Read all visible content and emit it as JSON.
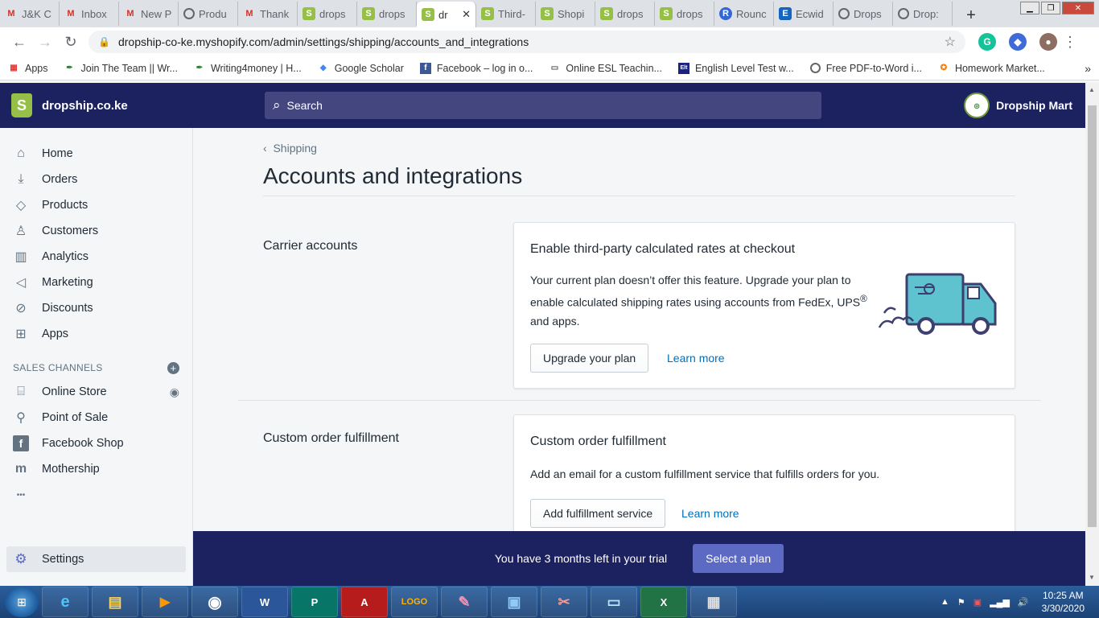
{
  "browser": {
    "tabs": [
      {
        "label": "J&K C",
        "icon": "gmail-icon",
        "glyph": "M"
      },
      {
        "label": "Inbox",
        "icon": "gmail-icon",
        "glyph": "M"
      },
      {
        "label": "New P",
        "icon": "gmail-icon",
        "glyph": "M"
      },
      {
        "label": "Produ",
        "icon": "globe-icon",
        "glyph": ""
      },
      {
        "label": "Thank",
        "icon": "gmail-icon",
        "glyph": "M"
      },
      {
        "label": "drops",
        "icon": "shopify-icon",
        "glyph": "S"
      },
      {
        "label": "drops",
        "icon": "shopify-icon",
        "glyph": "S"
      },
      {
        "label": "dr",
        "icon": "shopify-icon",
        "glyph": "S",
        "active": true
      },
      {
        "label": "Third-",
        "icon": "shopify-icon",
        "glyph": "S"
      },
      {
        "label": "Shopi",
        "icon": "shopify-icon",
        "glyph": "S"
      },
      {
        "label": "drops",
        "icon": "shopify-icon",
        "glyph": "S"
      },
      {
        "label": "drops",
        "icon": "shopify-icon",
        "glyph": "S"
      },
      {
        "label": "Rounc",
        "icon": "roundcube-icon",
        "glyph": "R"
      },
      {
        "label": "Ecwid",
        "icon": "ecwid-icon",
        "glyph": "E"
      },
      {
        "label": "Drops",
        "icon": "globe-icon",
        "glyph": ""
      },
      {
        "label": "Drop:",
        "icon": "globe-icon",
        "glyph": ""
      }
    ],
    "url": "dropship-co-ke.myshopify.com/admin/settings/shipping/accounts_and_integrations",
    "bookmarks": [
      {
        "label": "Apps",
        "icon": "apps-grid-icon"
      },
      {
        "label": "Join The Team || Wr...",
        "icon": "feather-icon"
      },
      {
        "label": "Writing4money | H...",
        "icon": "feather-icon"
      },
      {
        "label": "Google Scholar",
        "icon": "scholar-cap-icon"
      },
      {
        "label": "Facebook – log in o...",
        "icon": "facebook-icon"
      },
      {
        "label": "Online ESL Teachin...",
        "icon": "monitor-icon"
      },
      {
        "label": "English Level Test w...",
        "icon": "elt-icon"
      },
      {
        "label": "Free PDF-to-Word i...",
        "icon": "globe-icon"
      },
      {
        "label": "Homework Market...",
        "icon": "homework-icon"
      }
    ]
  },
  "topbar": {
    "store_name": "dropship.co.ke",
    "search_placeholder": "Search",
    "account_name": "Dropship Mart"
  },
  "sidebar": {
    "items": [
      {
        "label": "Home",
        "icon": "home-icon"
      },
      {
        "label": "Orders",
        "icon": "orders-icon"
      },
      {
        "label": "Products",
        "icon": "tag-icon"
      },
      {
        "label": "Customers",
        "icon": "person-icon"
      },
      {
        "label": "Analytics",
        "icon": "bar-chart-icon"
      },
      {
        "label": "Marketing",
        "icon": "megaphone-icon"
      },
      {
        "label": "Discounts",
        "icon": "discount-icon"
      },
      {
        "label": "Apps",
        "icon": "apps-icon"
      }
    ],
    "channels_heading": "SALES CHANNELS",
    "channels": [
      {
        "label": "Online Store",
        "icon": "store-icon"
      },
      {
        "label": "Point of Sale",
        "icon": "pos-bag-icon"
      },
      {
        "label": "Facebook Shop",
        "icon": "facebook-icon"
      },
      {
        "label": "Mothership",
        "icon": "mothership-icon"
      }
    ],
    "more": "•••",
    "settings_label": "Settings"
  },
  "main": {
    "breadcrumb": "Shipping",
    "title": "Accounts and integrations",
    "carrier": {
      "section_title": "Carrier accounts",
      "card_title": "Enable third-party calculated rates at checkout",
      "text_line1": "Your current plan doesn’t offer this feature. Upgrade your plan to",
      "text_line2": "enable calculated shipping rates using accounts from FedEx, UPS",
      "text_sup": "®",
      "text_line3": "and apps.",
      "button": "Upgrade your plan",
      "link": "Learn more"
    },
    "fulfillment": {
      "section_title": "Custom order fulfillment",
      "card_title": "Custom order fulfillment",
      "text": "Add an email for a custom fulfillment service that fulfills orders for you.",
      "button": "Add fulfillment service",
      "link": "Learn more"
    }
  },
  "trial": {
    "text": "You have 3 months left in your trial",
    "button": "Select a plan"
  },
  "taskbar": {
    "apps": [
      "Internet Explorer",
      "File Explorer",
      "Media Player",
      "Chrome",
      "Word",
      "Publisher",
      "Adobe Reader",
      "Logo Maker",
      "Paint",
      "Photo Viewer",
      "Snipping Tool",
      "Remote Desktop",
      "Excel",
      "Calculator"
    ],
    "time": "10:25 AM",
    "date": "3/30/2020"
  },
  "colors": {
    "topbar_bg": "#1c2260",
    "accent": "#5c6ac4",
    "link": "#006fbb",
    "shopify_green": "#95bf47"
  }
}
